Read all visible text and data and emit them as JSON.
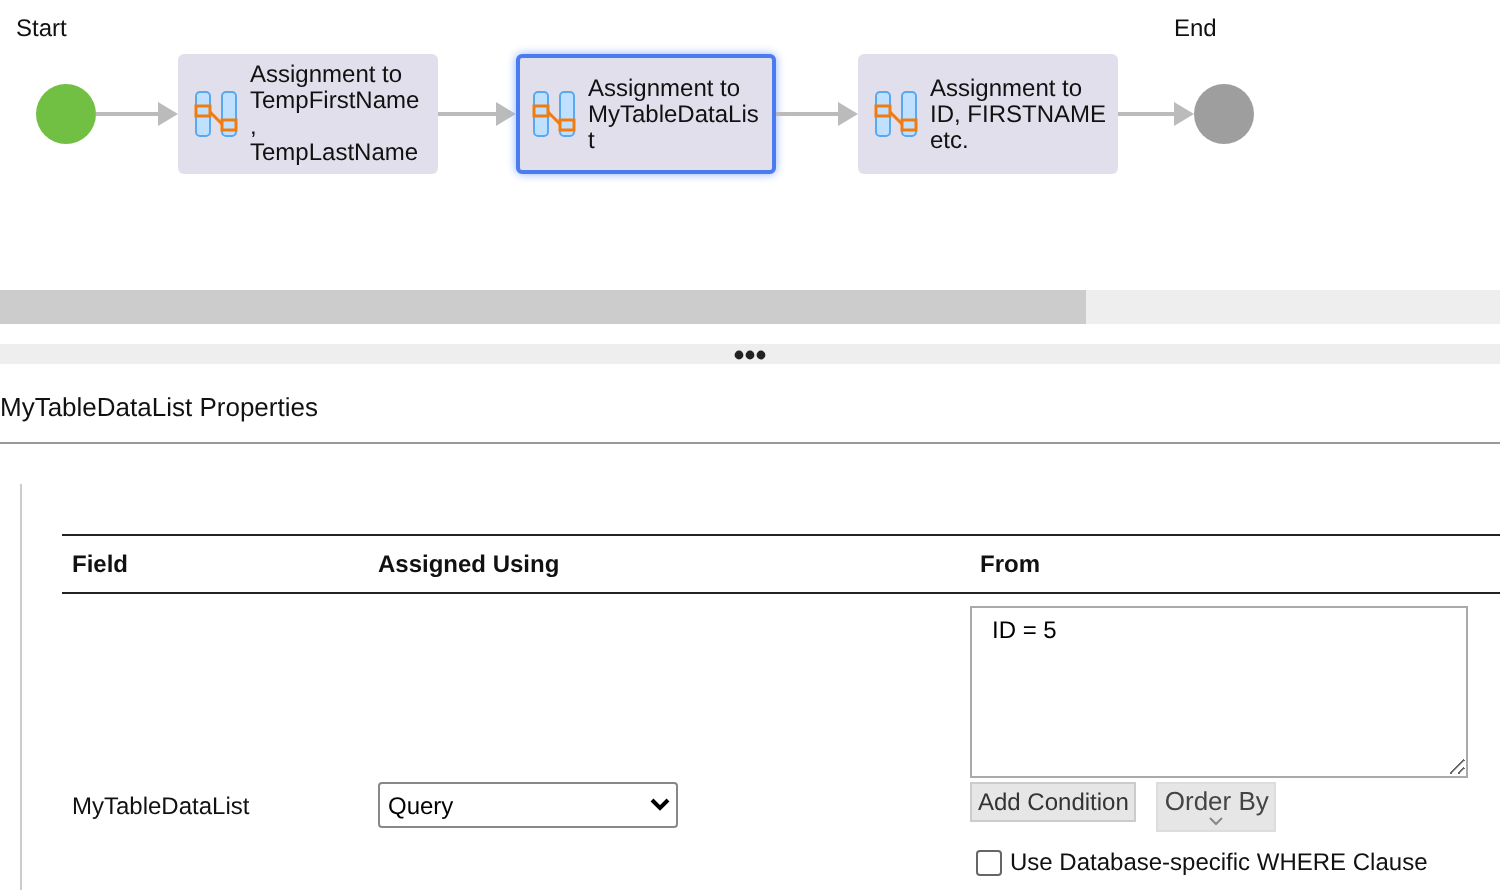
{
  "diagram": {
    "nodes": [
      {
        "kind": "start",
        "label": "Start"
      },
      {
        "kind": "assignment",
        "label": "Assignment to TempFirstName, TempLastName",
        "selected": false
      },
      {
        "kind": "assignment",
        "label": "Assignment to MyTableDataList",
        "selected": true
      },
      {
        "kind": "assignment",
        "label": "Assignment to ID, FIRSTNAME etc.",
        "selected": false
      },
      {
        "kind": "end",
        "label": "End"
      }
    ]
  },
  "properties": {
    "title": "MyTableDataList Properties",
    "table": {
      "columns": [
        "Field",
        "Assigned Using",
        "From"
      ],
      "rows": [
        {
          "field": "MyTableDataList",
          "assigned_using": "Query",
          "from": "ID = 5",
          "add_condition": "Add Condition",
          "order_by": "Order By",
          "where_clause": {
            "label": "Use Database-specific WHERE Clause",
            "checked": false
          }
        }
      ]
    }
  }
}
